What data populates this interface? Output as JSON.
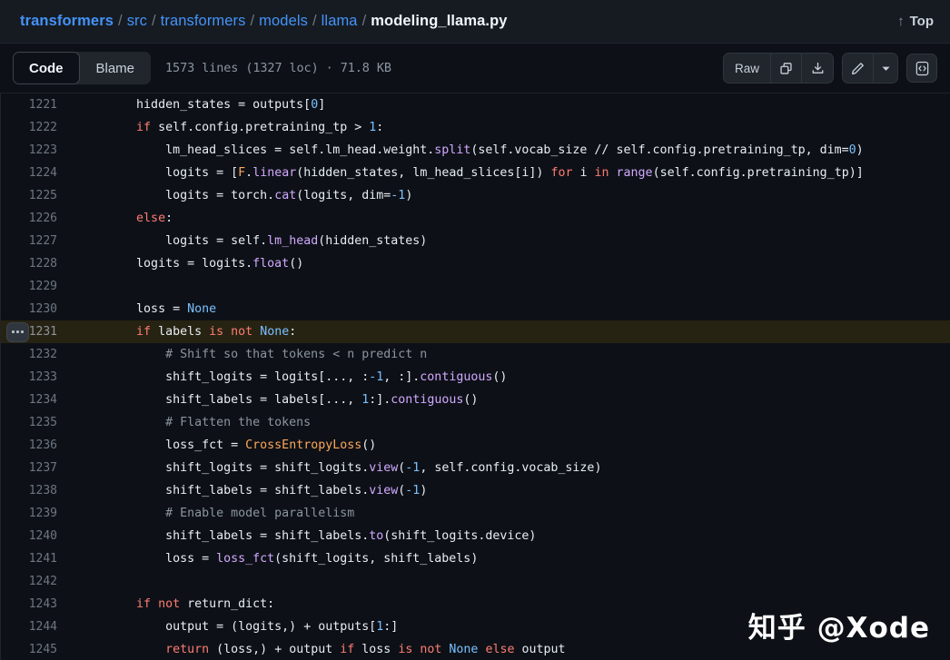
{
  "header": {
    "breadcrumb": [
      {
        "label": "transformers",
        "type": "link-bold"
      },
      {
        "label": "src",
        "type": "link"
      },
      {
        "label": "transformers",
        "type": "link"
      },
      {
        "label": "models",
        "type": "link"
      },
      {
        "label": "llama",
        "type": "link"
      },
      {
        "label": "modeling_llama.py",
        "type": "current"
      }
    ],
    "separator": "/",
    "top_link": {
      "label": "Top",
      "icon": "arrow-up-icon",
      "arrow": "↑"
    }
  },
  "toolbar": {
    "tabs": [
      {
        "label": "Code",
        "active": true
      },
      {
        "label": "Blame",
        "active": false
      }
    ],
    "file_meta": "1573 lines (1327 loc) · 71.8 KB",
    "lines": "1573 lines",
    "loc": "(1327 loc)",
    "size": "71.8 KB",
    "raw_label": "Raw",
    "icons": {
      "copy": "copy-icon",
      "download": "download-icon",
      "edit": "pencil-icon",
      "caret": "chevron-down-icon",
      "symbols": "code-brackets-icon"
    }
  },
  "colors": {
    "page_bg": "#0d1117",
    "header_bg": "#161b22",
    "accent_link": "#4493f8",
    "highlight_row": "#272312",
    "keyword": "#ff7b72",
    "function": "#d2a8ff",
    "constant": "#79c0ff",
    "class": "#ffa657",
    "comment": "#8b949e",
    "text": "#e6edf3",
    "line_number": "#6e7681"
  },
  "watermark": "知乎 @Xode",
  "code": {
    "first_line": 1221,
    "highlighted_line": 1231,
    "gutter_menu_icon": "kebab-menu-icon",
    "lines": [
      {
        "n": 1221,
        "tokens": [
          {
            "t": "        ",
            "c": "plain"
          },
          {
            "t": "hidden_states ",
            "c": "plain"
          },
          {
            "t": "= ",
            "c": "op"
          },
          {
            "t": "outputs[",
            "c": "plain"
          },
          {
            "t": "0",
            "c": "num"
          },
          {
            "t": "]",
            "c": "plain"
          }
        ]
      },
      {
        "n": 1222,
        "tokens": [
          {
            "t": "        ",
            "c": "plain"
          },
          {
            "t": "if",
            "c": "kw"
          },
          {
            "t": " self.config.pretraining_tp ",
            "c": "plain"
          },
          {
            "t": "> ",
            "c": "op"
          },
          {
            "t": "1",
            "c": "num"
          },
          {
            "t": ":",
            "c": "plain"
          }
        ]
      },
      {
        "n": 1223,
        "tokens": [
          {
            "t": "            ",
            "c": "plain"
          },
          {
            "t": "lm_head_slices ",
            "c": "plain"
          },
          {
            "t": "= ",
            "c": "op"
          },
          {
            "t": "self.lm_head.weight.",
            "c": "plain"
          },
          {
            "t": "split",
            "c": "fn"
          },
          {
            "t": "(self.vocab_size ",
            "c": "plain"
          },
          {
            "t": "// ",
            "c": "op"
          },
          {
            "t": "self.config.pretraining_tp, dim=",
            "c": "plain"
          },
          {
            "t": "0",
            "c": "num"
          },
          {
            "t": ")",
            "c": "plain"
          }
        ]
      },
      {
        "n": 1224,
        "tokens": [
          {
            "t": "            ",
            "c": "plain"
          },
          {
            "t": "logits ",
            "c": "plain"
          },
          {
            "t": "= ",
            "c": "op"
          },
          {
            "t": "[",
            "c": "plain"
          },
          {
            "t": "F",
            "c": "cls"
          },
          {
            "t": ".",
            "c": "plain"
          },
          {
            "t": "linear",
            "c": "fn"
          },
          {
            "t": "(hidden_states, lm_head_slices[i]) ",
            "c": "plain"
          },
          {
            "t": "for",
            "c": "kw"
          },
          {
            "t": " i ",
            "c": "plain"
          },
          {
            "t": "in",
            "c": "kw"
          },
          {
            "t": " ",
            "c": "plain"
          },
          {
            "t": "range",
            "c": "fn"
          },
          {
            "t": "(self.config.pretraining_tp)]",
            "c": "plain"
          }
        ]
      },
      {
        "n": 1225,
        "tokens": [
          {
            "t": "            ",
            "c": "plain"
          },
          {
            "t": "logits ",
            "c": "plain"
          },
          {
            "t": "= ",
            "c": "op"
          },
          {
            "t": "torch.",
            "c": "plain"
          },
          {
            "t": "cat",
            "c": "fn"
          },
          {
            "t": "(logits, dim=",
            "c": "plain"
          },
          {
            "t": "-1",
            "c": "num"
          },
          {
            "t": ")",
            "c": "plain"
          }
        ]
      },
      {
        "n": 1226,
        "tokens": [
          {
            "t": "        ",
            "c": "plain"
          },
          {
            "t": "else",
            "c": "kw"
          },
          {
            "t": ":",
            "c": "plain"
          }
        ]
      },
      {
        "n": 1227,
        "tokens": [
          {
            "t": "            ",
            "c": "plain"
          },
          {
            "t": "logits ",
            "c": "plain"
          },
          {
            "t": "= ",
            "c": "op"
          },
          {
            "t": "self.",
            "c": "plain"
          },
          {
            "t": "lm_head",
            "c": "fn"
          },
          {
            "t": "(hidden_states)",
            "c": "plain"
          }
        ]
      },
      {
        "n": 1228,
        "tokens": [
          {
            "t": "        ",
            "c": "plain"
          },
          {
            "t": "logits ",
            "c": "plain"
          },
          {
            "t": "= ",
            "c": "op"
          },
          {
            "t": "logits.",
            "c": "plain"
          },
          {
            "t": "float",
            "c": "fn"
          },
          {
            "t": "()",
            "c": "plain"
          }
        ]
      },
      {
        "n": 1229,
        "tokens": []
      },
      {
        "n": 1230,
        "tokens": [
          {
            "t": "        ",
            "c": "plain"
          },
          {
            "t": "loss ",
            "c": "plain"
          },
          {
            "t": "= ",
            "c": "op"
          },
          {
            "t": "None",
            "c": "const"
          }
        ]
      },
      {
        "n": 1231,
        "highlight": true,
        "tokens": [
          {
            "t": "        ",
            "c": "plain"
          },
          {
            "t": "if",
            "c": "kw"
          },
          {
            "t": " labels ",
            "c": "plain"
          },
          {
            "t": "is",
            "c": "kw"
          },
          {
            "t": " ",
            "c": "plain"
          },
          {
            "t": "not",
            "c": "kw"
          },
          {
            "t": " ",
            "c": "plain"
          },
          {
            "t": "None",
            "c": "const"
          },
          {
            "t": ":",
            "c": "plain"
          }
        ]
      },
      {
        "n": 1232,
        "tokens": [
          {
            "t": "            ",
            "c": "plain"
          },
          {
            "t": "# Shift so that tokens < n predict n",
            "c": "cmt"
          }
        ]
      },
      {
        "n": 1233,
        "tokens": [
          {
            "t": "            ",
            "c": "plain"
          },
          {
            "t": "shift_logits ",
            "c": "plain"
          },
          {
            "t": "= ",
            "c": "op"
          },
          {
            "t": "logits[..., :",
            "c": "plain"
          },
          {
            "t": "-1",
            "c": "num"
          },
          {
            "t": ", :].",
            "c": "plain"
          },
          {
            "t": "contiguous",
            "c": "fn"
          },
          {
            "t": "()",
            "c": "plain"
          }
        ]
      },
      {
        "n": 1234,
        "tokens": [
          {
            "t": "            ",
            "c": "plain"
          },
          {
            "t": "shift_labels ",
            "c": "plain"
          },
          {
            "t": "= ",
            "c": "op"
          },
          {
            "t": "labels[..., ",
            "c": "plain"
          },
          {
            "t": "1",
            "c": "num"
          },
          {
            "t": ":].",
            "c": "plain"
          },
          {
            "t": "contiguous",
            "c": "fn"
          },
          {
            "t": "()",
            "c": "plain"
          }
        ]
      },
      {
        "n": 1235,
        "tokens": [
          {
            "t": "            ",
            "c": "plain"
          },
          {
            "t": "# Flatten the tokens",
            "c": "cmt"
          }
        ]
      },
      {
        "n": 1236,
        "tokens": [
          {
            "t": "            ",
            "c": "plain"
          },
          {
            "t": "loss_fct ",
            "c": "plain"
          },
          {
            "t": "= ",
            "c": "op"
          },
          {
            "t": "CrossEntropyLoss",
            "c": "cls"
          },
          {
            "t": "()",
            "c": "plain"
          }
        ]
      },
      {
        "n": 1237,
        "tokens": [
          {
            "t": "            ",
            "c": "plain"
          },
          {
            "t": "shift_logits ",
            "c": "plain"
          },
          {
            "t": "= ",
            "c": "op"
          },
          {
            "t": "shift_logits.",
            "c": "plain"
          },
          {
            "t": "view",
            "c": "fn"
          },
          {
            "t": "(",
            "c": "plain"
          },
          {
            "t": "-1",
            "c": "num"
          },
          {
            "t": ", self.config.vocab_size)",
            "c": "plain"
          }
        ]
      },
      {
        "n": 1238,
        "tokens": [
          {
            "t": "            ",
            "c": "plain"
          },
          {
            "t": "shift_labels ",
            "c": "plain"
          },
          {
            "t": "= ",
            "c": "op"
          },
          {
            "t": "shift_labels.",
            "c": "plain"
          },
          {
            "t": "view",
            "c": "fn"
          },
          {
            "t": "(",
            "c": "plain"
          },
          {
            "t": "-1",
            "c": "num"
          },
          {
            "t": ")",
            "c": "plain"
          }
        ]
      },
      {
        "n": 1239,
        "tokens": [
          {
            "t": "            ",
            "c": "plain"
          },
          {
            "t": "# Enable model parallelism",
            "c": "cmt"
          }
        ]
      },
      {
        "n": 1240,
        "tokens": [
          {
            "t": "            ",
            "c": "plain"
          },
          {
            "t": "shift_labels ",
            "c": "plain"
          },
          {
            "t": "= ",
            "c": "op"
          },
          {
            "t": "shift_labels.",
            "c": "plain"
          },
          {
            "t": "to",
            "c": "fn"
          },
          {
            "t": "(shift_logits.device)",
            "c": "plain"
          }
        ]
      },
      {
        "n": 1241,
        "tokens": [
          {
            "t": "            ",
            "c": "plain"
          },
          {
            "t": "loss ",
            "c": "plain"
          },
          {
            "t": "= ",
            "c": "op"
          },
          {
            "t": "loss_fct",
            "c": "fn"
          },
          {
            "t": "(shift_logits, shift_labels)",
            "c": "plain"
          }
        ]
      },
      {
        "n": 1242,
        "tokens": []
      },
      {
        "n": 1243,
        "tokens": [
          {
            "t": "        ",
            "c": "plain"
          },
          {
            "t": "if",
            "c": "kw"
          },
          {
            "t": " ",
            "c": "plain"
          },
          {
            "t": "not",
            "c": "kw"
          },
          {
            "t": " return_dict:",
            "c": "plain"
          }
        ]
      },
      {
        "n": 1244,
        "tokens": [
          {
            "t": "            ",
            "c": "plain"
          },
          {
            "t": "output ",
            "c": "plain"
          },
          {
            "t": "= ",
            "c": "op"
          },
          {
            "t": "(logits,) ",
            "c": "plain"
          },
          {
            "t": "+ ",
            "c": "op"
          },
          {
            "t": "outputs[",
            "c": "plain"
          },
          {
            "t": "1",
            "c": "num"
          },
          {
            "t": ":]",
            "c": "plain"
          }
        ]
      },
      {
        "n": 1245,
        "tokens": [
          {
            "t": "            ",
            "c": "plain"
          },
          {
            "t": "return",
            "c": "kw"
          },
          {
            "t": " (loss,) ",
            "c": "plain"
          },
          {
            "t": "+ ",
            "c": "op"
          },
          {
            "t": "output ",
            "c": "plain"
          },
          {
            "t": "if",
            "c": "kw"
          },
          {
            "t": " loss ",
            "c": "plain"
          },
          {
            "t": "is",
            "c": "kw"
          },
          {
            "t": " ",
            "c": "plain"
          },
          {
            "t": "not",
            "c": "kw"
          },
          {
            "t": " ",
            "c": "plain"
          },
          {
            "t": "None",
            "c": "const"
          },
          {
            "t": " ",
            "c": "plain"
          },
          {
            "t": "else",
            "c": "kw"
          },
          {
            "t": " output",
            "c": "plain"
          }
        ]
      }
    ]
  }
}
